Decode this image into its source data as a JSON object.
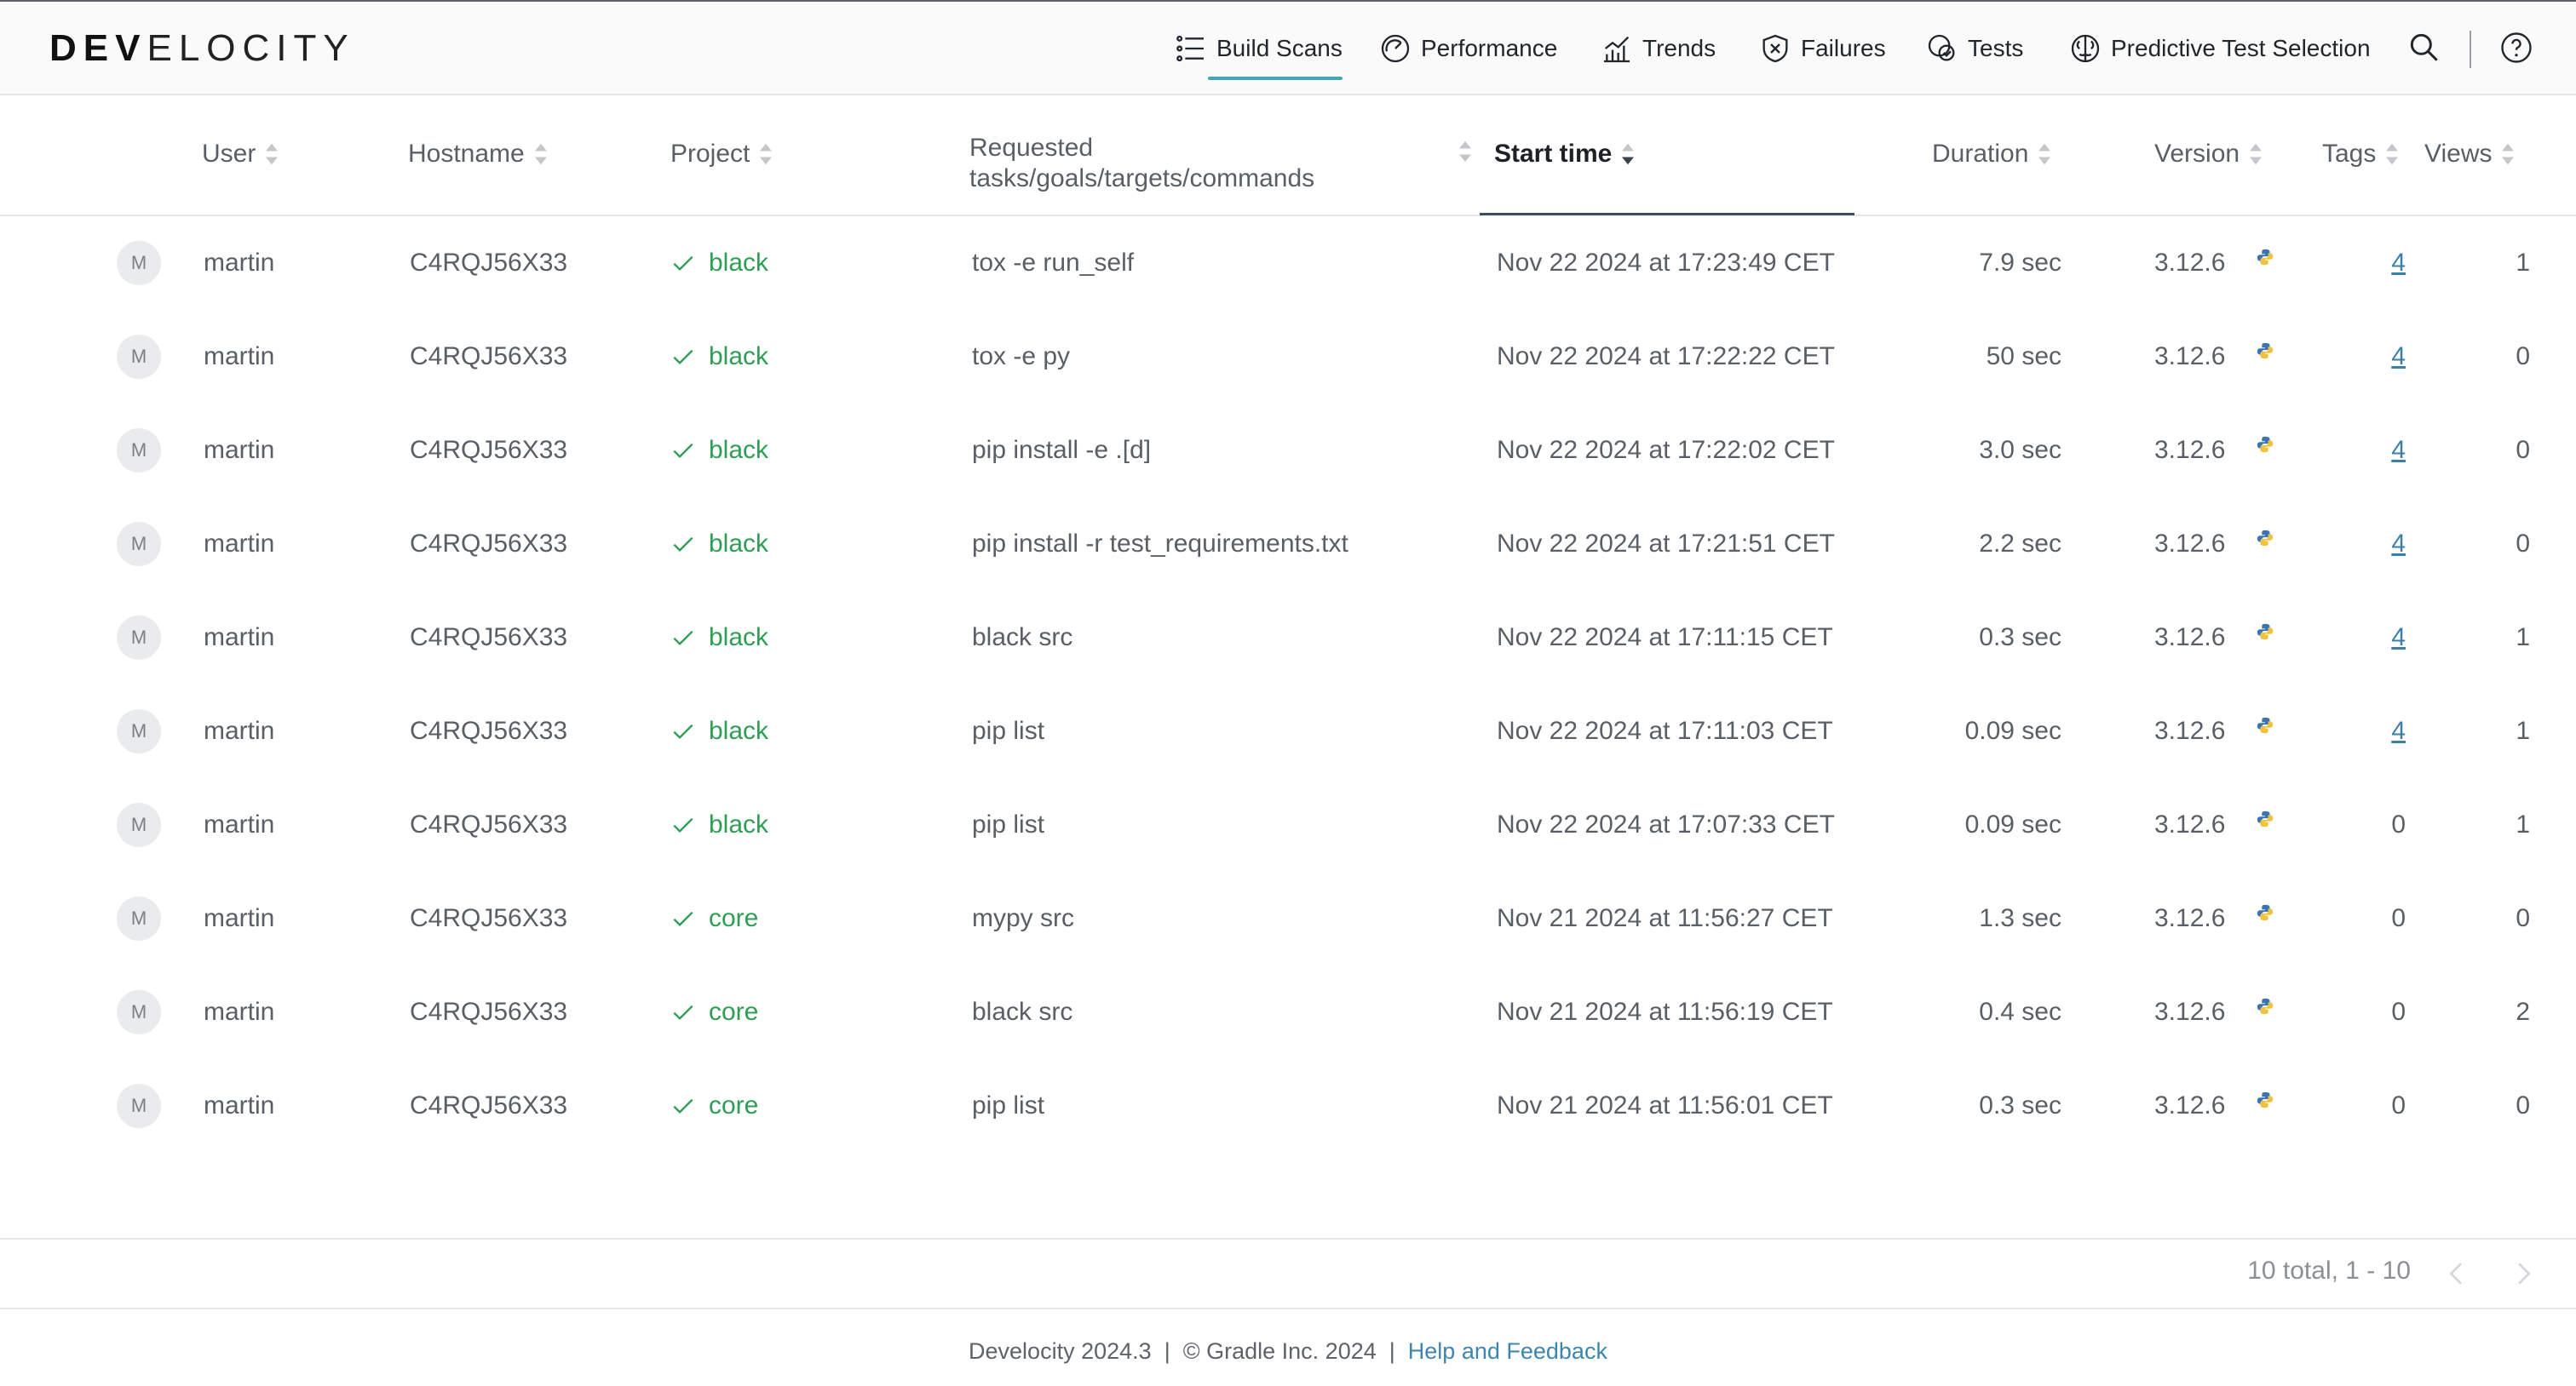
{
  "brand": {
    "bold": "DEV",
    "light": "ELOCITY"
  },
  "nav": [
    {
      "label": "Build Scans",
      "icon": "list-icon",
      "active": true
    },
    {
      "label": "Performance",
      "icon": "gauge-icon"
    },
    {
      "label": "Trends",
      "icon": "chart-icon"
    },
    {
      "label": "Failures",
      "icon": "shield-x-icon"
    },
    {
      "label": "Tests",
      "icon": "tests-icon"
    },
    {
      "label": "Predictive Test Selection",
      "icon": "brain-icon"
    }
  ],
  "columns": {
    "user": "User",
    "hostname": "Hostname",
    "project": "Project",
    "requested_line1": "Requested",
    "requested_line2": "tasks/goals/targets/commands",
    "start_time": "Start time",
    "duration": "Duration",
    "version": "Version",
    "tags": "Tags",
    "views": "Views"
  },
  "rows": [
    {
      "avatar": "M",
      "user": "martin",
      "host": "C4RQJ56X33",
      "project": "black",
      "command": "tox -e run_self",
      "start": "Nov 22 2024 at 17:23:49 CET",
      "duration": "7.9 sec",
      "version": "3.12.6",
      "tags": "4",
      "views": "1"
    },
    {
      "avatar": "M",
      "user": "martin",
      "host": "C4RQJ56X33",
      "project": "black",
      "command": "tox -e py",
      "start": "Nov 22 2024 at 17:22:22 CET",
      "duration": "50 sec",
      "version": "3.12.6",
      "tags": "4",
      "views": "0"
    },
    {
      "avatar": "M",
      "user": "martin",
      "host": "C4RQJ56X33",
      "project": "black",
      "command": "pip install -e .[d]",
      "start": "Nov 22 2024 at 17:22:02 CET",
      "duration": "3.0 sec",
      "version": "3.12.6",
      "tags": "4",
      "views": "0"
    },
    {
      "avatar": "M",
      "user": "martin",
      "host": "C4RQJ56X33",
      "project": "black",
      "command": "pip install -r test_requirements.txt",
      "start": "Nov 22 2024 at 17:21:51 CET",
      "duration": "2.2 sec",
      "version": "3.12.6",
      "tags": "4",
      "views": "0"
    },
    {
      "avatar": "M",
      "user": "martin",
      "host": "C4RQJ56X33",
      "project": "black",
      "command": "black src",
      "start": "Nov 22 2024 at 17:11:15 CET",
      "duration": "0.3 sec",
      "version": "3.12.6",
      "tags": "4",
      "views": "1"
    },
    {
      "avatar": "M",
      "user": "martin",
      "host": "C4RQJ56X33",
      "project": "black",
      "command": "pip list",
      "start": "Nov 22 2024 at 17:11:03 CET",
      "duration": "0.09 sec",
      "version": "3.12.6",
      "tags": "4",
      "views": "1"
    },
    {
      "avatar": "M",
      "user": "martin",
      "host": "C4RQJ56X33",
      "project": "black",
      "command": "pip list",
      "start": "Nov 22 2024 at 17:07:33 CET",
      "duration": "0.09 sec",
      "version": "3.12.6",
      "tags": "0",
      "views": "1"
    },
    {
      "avatar": "M",
      "user": "martin",
      "host": "C4RQJ56X33",
      "project": "core",
      "command": "mypy src",
      "start": "Nov 21 2024 at 11:56:27 CET",
      "duration": "1.3 sec",
      "version": "3.12.6",
      "tags": "0",
      "views": "0"
    },
    {
      "avatar": "M",
      "user": "martin",
      "host": "C4RQJ56X33",
      "project": "core",
      "command": "black src",
      "start": "Nov 21 2024 at 11:56:19 CET",
      "duration": "0.4 sec",
      "version": "3.12.6",
      "tags": "0",
      "views": "2"
    },
    {
      "avatar": "M",
      "user": "martin",
      "host": "C4RQJ56X33",
      "project": "core",
      "command": "pip list",
      "start": "Nov 21 2024 at 11:56:01 CET",
      "duration": "0.3 sec",
      "version": "3.12.6",
      "tags": "0",
      "views": "0"
    }
  ],
  "pager": {
    "text": "10 total, 1 - 10"
  },
  "footer": {
    "version": "Develocity 2024.3",
    "separator": "|",
    "copyright": "© Gradle Inc. 2024",
    "help": "Help and Feedback"
  },
  "colors": {
    "success": "#2e9e54",
    "accent": "#46a5b5",
    "link": "#3c86b0"
  }
}
